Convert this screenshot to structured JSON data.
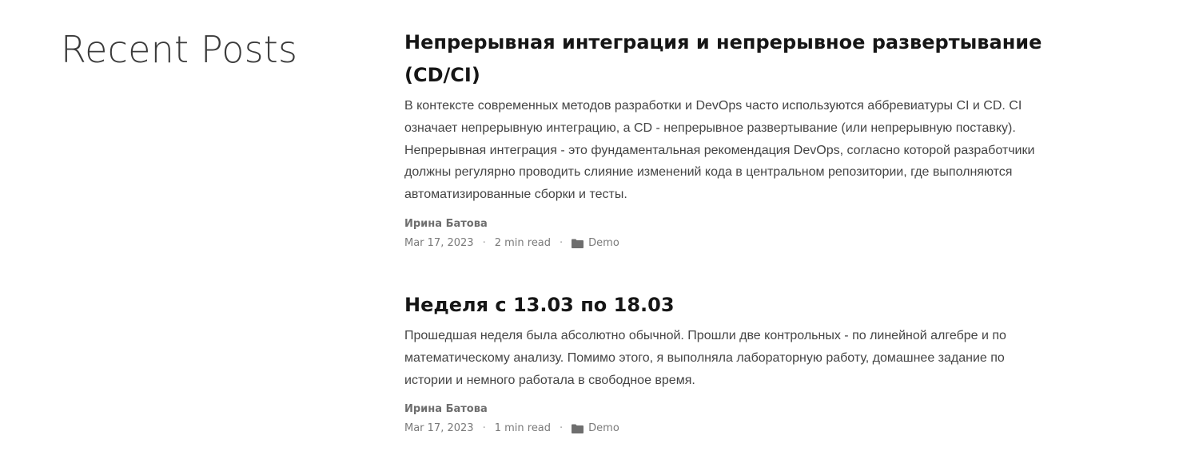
{
  "page": {
    "heading": "Recent Posts"
  },
  "posts": [
    {
      "title": "Непрерывная интеграция и непрерывное развертывание (CD/CI)",
      "excerpt": "В контексте современных методов разработки и DevOps часто используются аббревиатуры CI и CD. CI означает непрерывную интеграцию, а CD - непрерывное развертывание (или непрерывную поставку). Непрерывная интеграция - это фундаментальная рекомендация DevOps, согласно которой разработчики должны регулярно проводить слияние изменений кода в центральном репозитории, где выполняются автоматизированные сборки и тесты.",
      "author": "Ирина Батова",
      "date": "Mar 17, 2023",
      "separator": "·",
      "read_time": "2 min read",
      "category_icon": "folder-icon",
      "category": "Demo"
    },
    {
      "title": "Неделя с 13.03 по 18.03",
      "excerpt": "Прошедшая неделя была абсолютно обычной. Прошли две контрольных - по линейной алгебре и по математическому анализу. Помимо этого, я выполняла лабораторную работу, домашнее задание по истории и немного работала в свободное время.",
      "author": "Ирина Батова",
      "date": "Mar 17, 2023",
      "separator": "·",
      "read_time": "1 min read",
      "category_icon": "folder-icon",
      "category": "Demo"
    }
  ],
  "colors": {
    "title": "#161616",
    "text": "#444444",
    "meta": "#7a7a7a"
  }
}
